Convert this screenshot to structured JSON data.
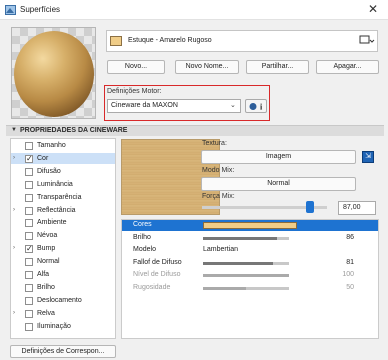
{
  "window": {
    "title": "Superfícies",
    "close": "✕"
  },
  "material": {
    "name": "Estuque - Amarelo Rugoso",
    "swatch_color": "#f0cd88"
  },
  "buttons": {
    "new": "Novo...",
    "new_name": "Novo Nome...",
    "share": "Partilhar...",
    "delete": "Apagar..."
  },
  "engine": {
    "label": "Definições Motor:",
    "value": "Cineware da MAXON",
    "info": "i"
  },
  "section": {
    "title": "PROPRIEDADES DA CINEWARE"
  },
  "channels": [
    {
      "label": "Tamanho",
      "checked": false,
      "arrow": ""
    },
    {
      "label": "Cor",
      "checked": true,
      "arrow": "›"
    },
    {
      "label": "Difusão",
      "checked": false,
      "arrow": ""
    },
    {
      "label": "Luminância",
      "checked": false,
      "arrow": ""
    },
    {
      "label": "Transparência",
      "checked": false,
      "arrow": ""
    },
    {
      "label": "Reflectância",
      "checked": false,
      "arrow": "›"
    },
    {
      "label": "Ambiente",
      "checked": false,
      "arrow": ""
    },
    {
      "label": "Névoa",
      "checked": false,
      "arrow": ""
    },
    {
      "label": "Bump",
      "checked": true,
      "arrow": "›"
    },
    {
      "label": "Normal",
      "checked": false,
      "arrow": ""
    },
    {
      "label": "Alfa",
      "checked": false,
      "arrow": ""
    },
    {
      "label": "Brilho",
      "checked": false,
      "arrow": ""
    },
    {
      "label": "Deslocamento",
      "checked": false,
      "arrow": ""
    },
    {
      "label": "Relva",
      "checked": false,
      "arrow": "›"
    },
    {
      "label": "Iluminação",
      "checked": false,
      "arrow": ""
    }
  ],
  "corresp_button": "Definições de Correspon...",
  "texture": {
    "label": "Textura:",
    "image_button": "Imagem",
    "mix_mode_label": "Modo Mix:",
    "mix_mode_value": "Normal",
    "mix_strength_label": "Força Mix:",
    "mix_strength_value": "87,00",
    "mix_strength_level": 0.87
  },
  "properties": [
    {
      "name": "Cores",
      "value": "",
      "level": null
    },
    {
      "name": "Brilho",
      "value": "86",
      "level": 0.86
    },
    {
      "name": "Modelo",
      "value": "Lambertian",
      "level": null
    },
    {
      "name": "Fallof de Difuso",
      "value": "81",
      "level": 0.81
    },
    {
      "name": "Nível de Difuso",
      "value": "100",
      "level": 1.0
    },
    {
      "name": "Rugosidade",
      "value": "50",
      "level": 0.5
    }
  ],
  "colors": {
    "accent": "#1e73d1",
    "highlight_frame": "#d8292a"
  }
}
